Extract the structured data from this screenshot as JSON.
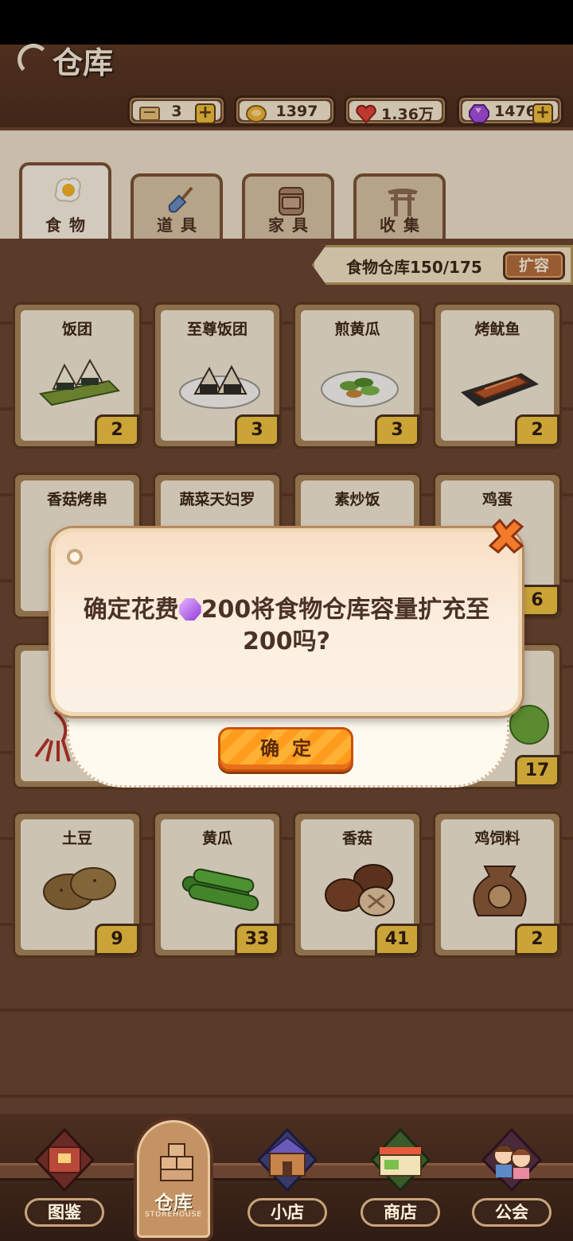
{
  "header": {
    "title": "仓库",
    "resources": [
      {
        "icon": "ticket-icon",
        "value": "3",
        "has_plus": true
      },
      {
        "icon": "coin-icon",
        "value": "1397",
        "has_plus": false
      },
      {
        "icon": "heart-icon",
        "value": "1.36万",
        "has_plus": false
      },
      {
        "icon": "gem-icon",
        "value": "1476",
        "has_plus": true
      }
    ]
  },
  "tabs": [
    {
      "label": "食物",
      "icon": "egg-icon",
      "active": true
    },
    {
      "label": "道具",
      "icon": "shovel-icon",
      "active": false
    },
    {
      "label": "家具",
      "icon": "cabinet-icon",
      "active": false
    },
    {
      "label": "收集",
      "icon": "torii-gate-icon",
      "active": false
    }
  ],
  "capacity": {
    "label": "食物仓库150/175",
    "expand_label": "扩容"
  },
  "items": [
    {
      "name": "饭团",
      "count": "2",
      "icon": "onigiri-icon"
    },
    {
      "name": "至尊饭团",
      "count": "3",
      "icon": "premium-onigiri-icon"
    },
    {
      "name": "煎黄瓜",
      "count": "3",
      "icon": "fried-cucumber-icon"
    },
    {
      "name": "烤鱿鱼",
      "count": "2",
      "icon": "grilled-squid-icon"
    },
    {
      "name": "香菇烤串",
      "count": "",
      "icon": "mushroom-skewer-icon"
    },
    {
      "name": "蔬菜天妇罗",
      "count": "",
      "icon": "tempura-icon"
    },
    {
      "name": "素炒饭",
      "count": "",
      "icon": "fried-rice-icon"
    },
    {
      "name": "鸡蛋",
      "count": "6",
      "icon": "egg-icon"
    },
    {
      "name": "",
      "count": "",
      "icon": "squid-icon"
    },
    {
      "name": "",
      "count": "17",
      "icon": "cabbage-icon"
    },
    {
      "name": "土豆",
      "count": "9",
      "icon": "potato-icon"
    },
    {
      "name": "黄瓜",
      "count": "33",
      "icon": "cucumber-icon"
    },
    {
      "name": "香菇",
      "count": "41",
      "icon": "mushroom-icon"
    },
    {
      "name": "鸡饲料",
      "count": "2",
      "icon": "chicken-feed-icon"
    }
  ],
  "dialog": {
    "message_before": "确定花费",
    "message_after": "200将食物仓库容量扩充至200吗?",
    "confirm_label": "确定"
  },
  "nav": [
    {
      "label": "图鉴",
      "icon": "book-icon",
      "active": false
    },
    {
      "label": "仓库",
      "sub": "STOREHOUSE",
      "icon": "storehouse-icon",
      "active": true
    },
    {
      "label": "小店",
      "icon": "shop-icon",
      "active": false
    },
    {
      "label": "商店",
      "icon": "store-icon",
      "active": false
    },
    {
      "label": "公会",
      "icon": "guild-icon",
      "active": false
    }
  ]
}
